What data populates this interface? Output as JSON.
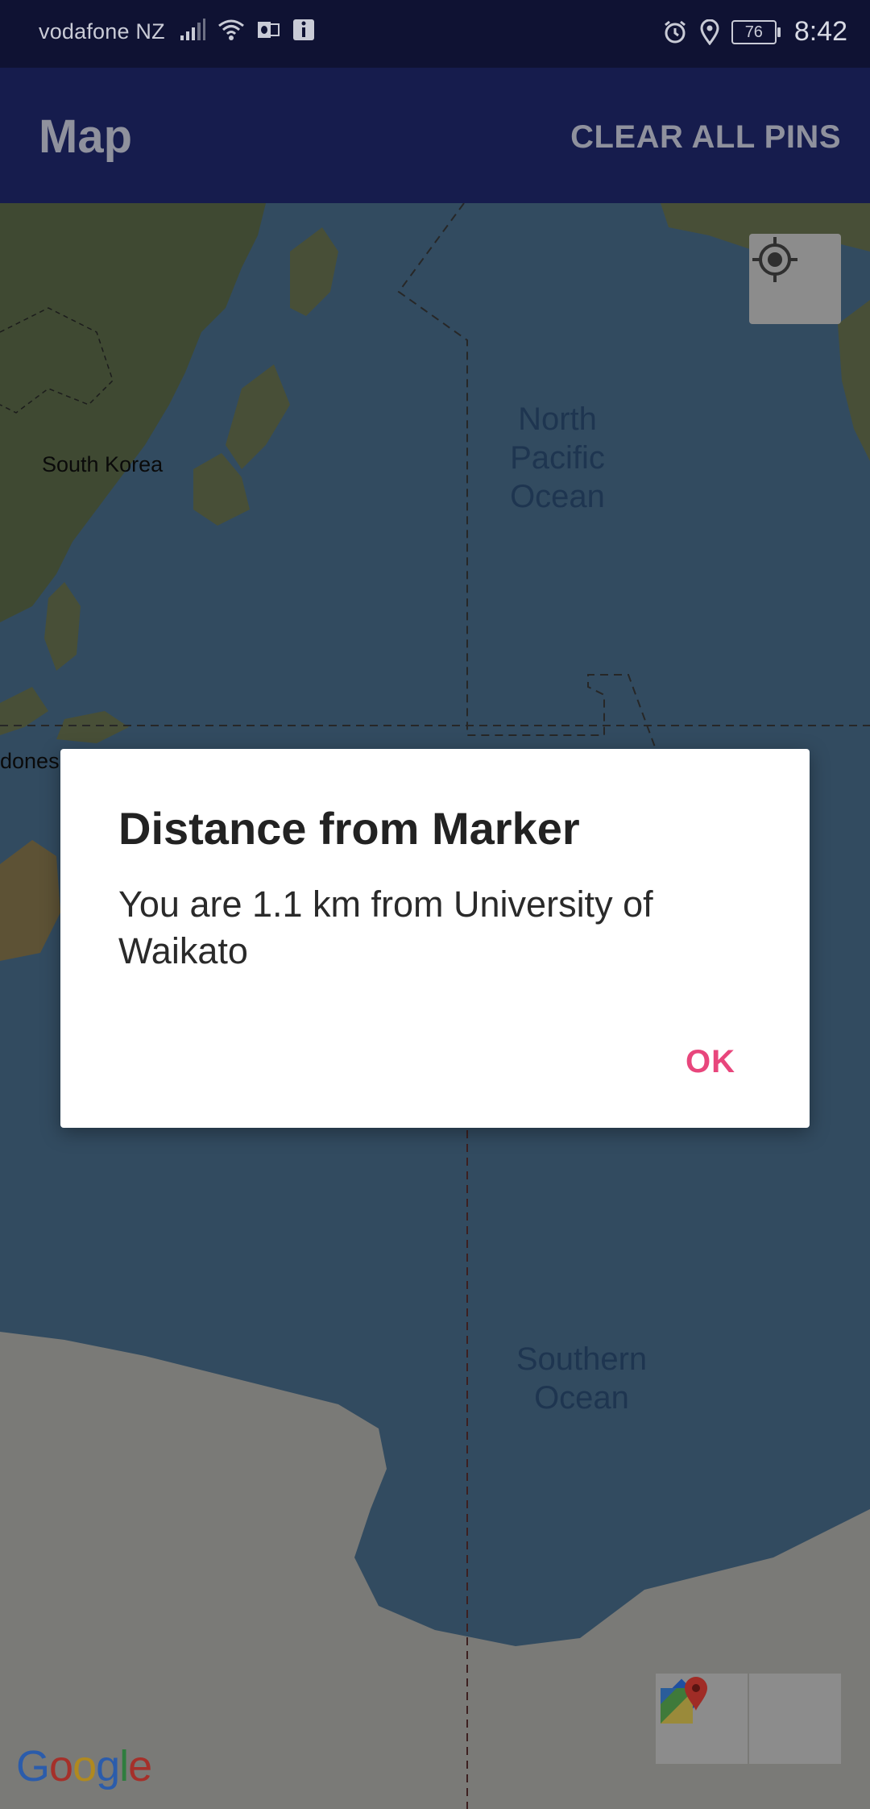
{
  "status_bar": {
    "carrier": "vodafone NZ",
    "battery": "76",
    "time": "8:42",
    "icons": [
      "signal-icon",
      "wifi-icon",
      "outlook-icon",
      "info-icon",
      "alarm-icon",
      "location-icon",
      "battery-icon"
    ]
  },
  "app_bar": {
    "title": "Map",
    "action_label": "CLEAR ALL PINS"
  },
  "map": {
    "labels": {
      "south_korea": "South Korea",
      "north_pacific": "North\nPacific\nOcean",
      "indonesia_partial": "donesi",
      "southern_ocean": "Southern\nOcean"
    },
    "google_logo": "Google",
    "controls": [
      "my-location-icon",
      "directions-icon",
      "google-maps-icon"
    ]
  },
  "dialog": {
    "title": "Distance from Marker",
    "message": "You are 1.1 km from University of Waikato",
    "ok_label": "OK"
  },
  "colors": {
    "status_bar": "#0f1233",
    "app_bar": "#161c4d",
    "accent": "#e8467c",
    "ocean": "#4a6f8e"
  }
}
